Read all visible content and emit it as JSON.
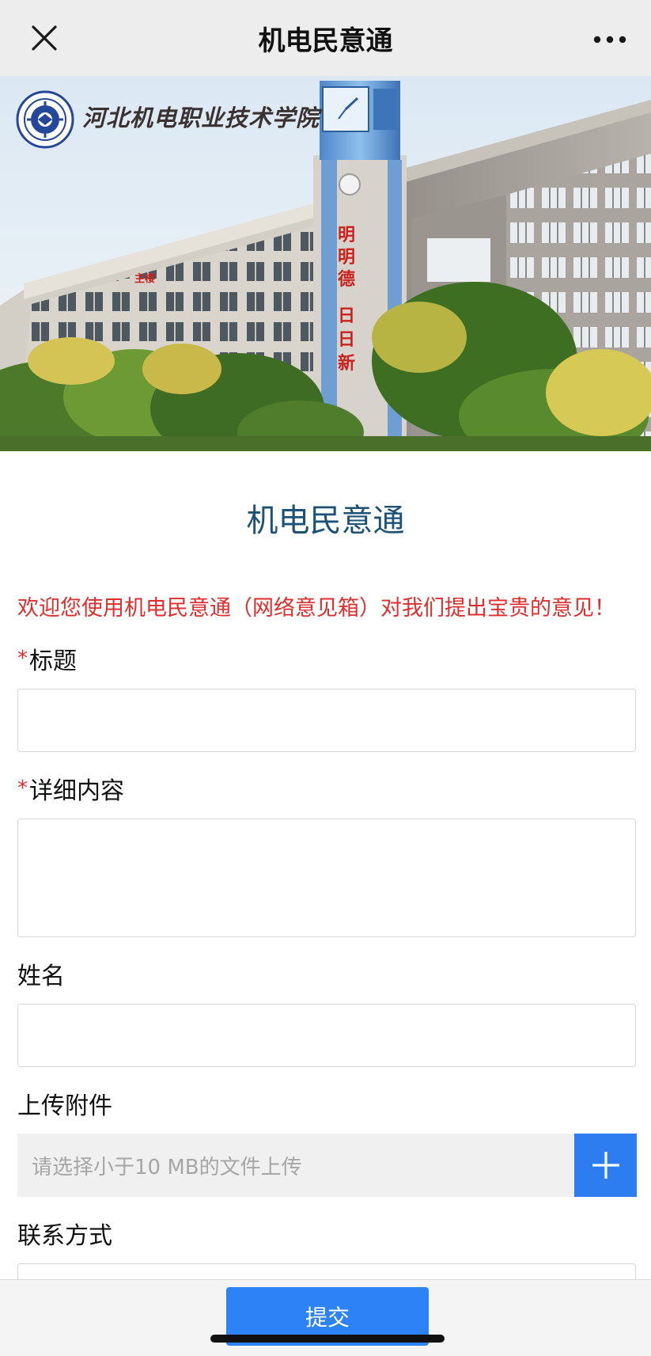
{
  "navbar": {
    "title": "机电民意通",
    "close_icon": "close-icon",
    "more_icon": "more-dots-icon"
  },
  "banner": {
    "school_name": "河北机电职业技术学院",
    "tower_text_1": "明明德",
    "tower_text_2": "日日新",
    "building_sign": "主楼",
    "logo_icon": "school-emblem-icon"
  },
  "form": {
    "title": "机电民意通",
    "welcome": "欢迎您使用机电民意通（网络意见箱）对我们提出宝贵的意见！",
    "required_mark": "*",
    "fields": {
      "title_label": "标题",
      "title_value": "",
      "content_label": "详细内容",
      "content_value": "",
      "name_label": "姓名",
      "name_value": "",
      "attachment_label": "上传附件",
      "attachment_placeholder": "请选择小于10 MB的文件上传",
      "contact_label": "联系方式",
      "contact_value": ""
    }
  },
  "bottom": {
    "submit_label": "提交"
  },
  "colors": {
    "accent_blue": "#2d82f6",
    "title_blue": "#1c5277",
    "welcome_red": "#e02d2d",
    "navbar_bg": "#ededed"
  }
}
